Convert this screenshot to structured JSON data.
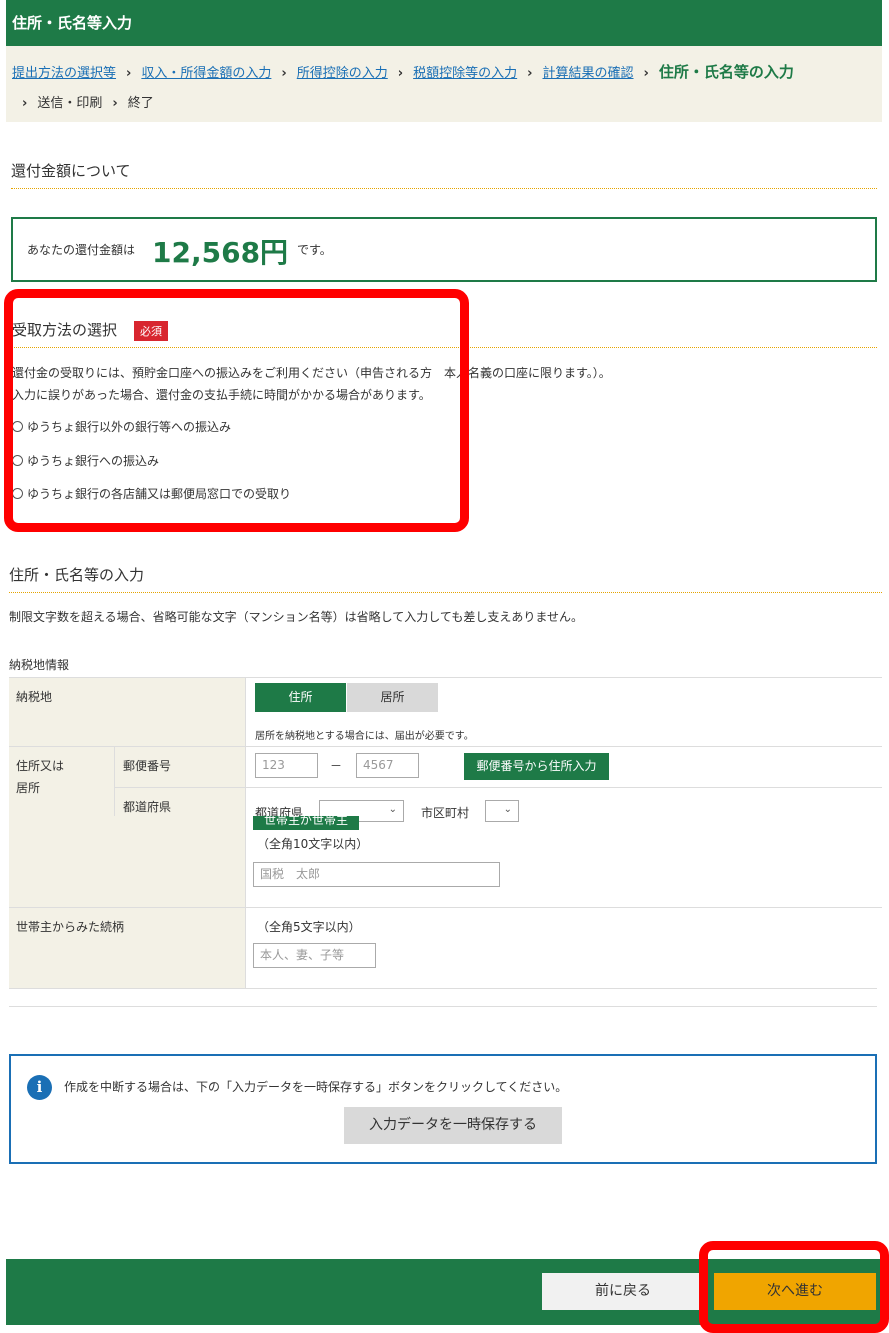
{
  "header": {
    "title": "住所・氏名等入力"
  },
  "breadcrumb": {
    "links": [
      "提出方法の選択等",
      "収入・所得金額の入力",
      "所得控除の入力",
      "税額控除等の入力",
      "計算結果の確認"
    ],
    "current": "住所・氏名等の入力",
    "following": [
      "送信・印刷",
      "終了"
    ],
    "separator": "›"
  },
  "refund": {
    "section_title": "還付金額について",
    "prefix": "あなたの還付金額は",
    "amount": "12,568円",
    "suffix": "です。"
  },
  "receipt": {
    "section_title": "受取方法の選択",
    "required_badge": "必須",
    "text1": "還付金の受取りには、預貯金口座への振込みをご利用ください（申告される方　本人名義の口座に限ります。）。",
    "text2": "入力に誤りがあった場合、還付金の支払手続に時間がかかる場合があります。",
    "options": [
      "ゆうちょ銀行以外の銀行等への振込み",
      "ゆうちょ銀行への振込み",
      "ゆうちょ銀行の各店舗又は郵便局窓口での受取り"
    ]
  },
  "address": {
    "section_title": "住所・氏名等の入力",
    "note": "制限文字数を超える場合、省略可能な文字（マンション名等）は省略して入力しても差し支えありません。",
    "tax_place_heading": "納税地情報",
    "tax_place_label": "納税地",
    "toggle": [
      "住所",
      "居所"
    ],
    "toggle_note": "居所を納税地とする場合には、届出が必要です。",
    "address_label": [
      "住所又は",
      "居所"
    ],
    "postal_label": "郵便番号",
    "postal_placeholder_1": "123",
    "postal_dash": "－",
    "postal_placeholder_2": "4567",
    "postal_button": "郵便番号から住所入力",
    "prefecture_label": "都道府県",
    "prefecture_inline": "都道府県",
    "city_inline": "市区町村",
    "householder_button_fragment": "世帯主が世帯主",
    "name_limit": "（全角10文字以内）",
    "name_placeholder": "国税　太郎",
    "relation_label": "世帯主からみた続柄",
    "relation_limit": "（全角5文字以内）",
    "relation_placeholder": "本人、妻、子等"
  },
  "info": {
    "icon": "i",
    "text": "作成を中断する場合は、下の「入力データを一時保存する」ボタンをクリックしてください。",
    "save_button": "入力データを一時保存する"
  },
  "footer": {
    "back_button": "前に戻る",
    "next_button": "次へ進む"
  },
  "colors": {
    "brand_green": "#1e7a47",
    "accent_orange": "#f0a500",
    "link_blue": "#1a6fb5",
    "highlight_red": "#ff0000",
    "required_red": "#d8262f"
  }
}
